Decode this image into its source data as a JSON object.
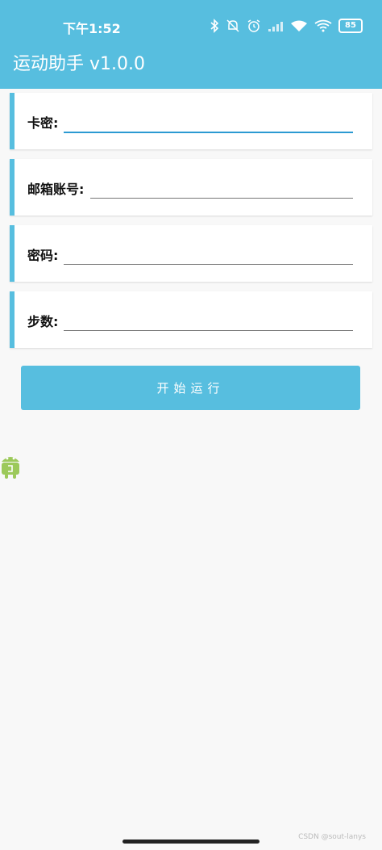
{
  "status_bar": {
    "time": "下午1:52",
    "battery": "85"
  },
  "app_bar": {
    "title": "运动助手 v1.0.0"
  },
  "form": {
    "fields": [
      {
        "label": "卡密:",
        "value": ""
      },
      {
        "label": "邮箱账号:",
        "value": ""
      },
      {
        "label": "密码:",
        "value": ""
      },
      {
        "label": "步数:",
        "value": ""
      }
    ],
    "submit_label": "开始运行"
  },
  "watermark": "CSDN @sout-lanys",
  "colors": {
    "accent": "#57bedf",
    "focus_underline": "#2c9ad2",
    "background": "#f8f8f8"
  }
}
